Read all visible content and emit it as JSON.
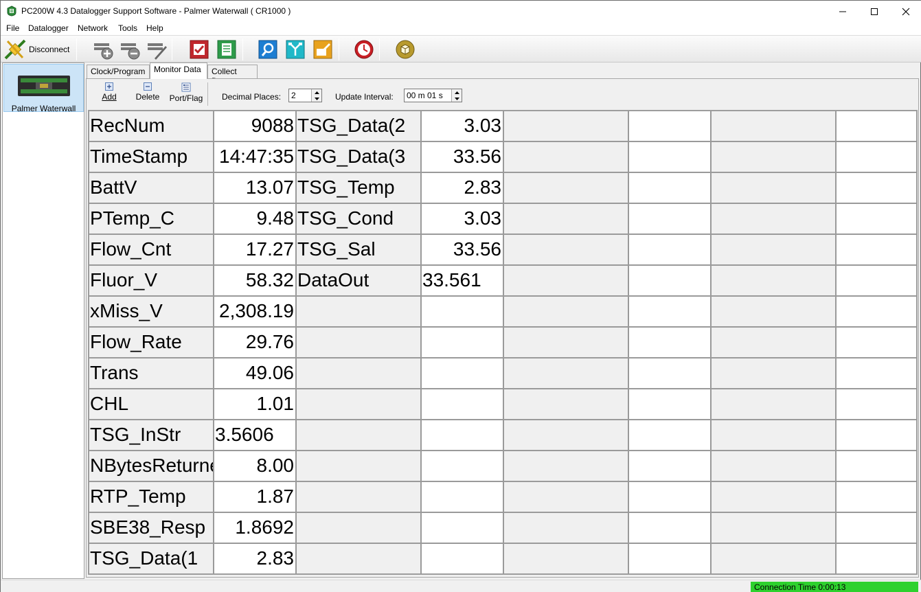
{
  "window": {
    "title": "PC200W 4.3 Datalogger Support Software - Palmer Waterwall ( CR1000 )",
    "minimize_icon": "minimize-icon",
    "maximize_icon": "maximize-icon",
    "close_icon": "close-icon"
  },
  "menu": [
    "File",
    "Datalogger",
    "Network",
    "Tools",
    "Help"
  ],
  "toolbar": {
    "disconnect_label": "Disconnect",
    "icons": [
      "add-datalogger-icon",
      "remove-datalogger-icon",
      "edit-datalogger-icon",
      "check-icon",
      "document-icon",
      "view-icon",
      "split-icon",
      "edit-file-icon",
      "clock-icon",
      "cube-icon"
    ]
  },
  "stations": [
    {
      "label": "Palmer Waterwall",
      "selected": true
    }
  ],
  "tabs": [
    {
      "label": "Clock/Program",
      "active": false
    },
    {
      "label": "Monitor Data",
      "active": true
    },
    {
      "label": "Collect Data",
      "active": false
    }
  ],
  "monitor": {
    "add_label": "Add",
    "delete_label": "Delete",
    "portflag_label": "Port/Flag",
    "decimal_places_label": "Decimal Places:",
    "decimal_places_value": "2",
    "update_interval_label": "Update Interval:",
    "update_interval_value": "00 m 01 s"
  },
  "grid": {
    "col1": [
      {
        "name": "RecNum",
        "value": "9088"
      },
      {
        "name": "TimeStamp",
        "value": "14:47:35"
      },
      {
        "name": "BattV",
        "value": "13.07"
      },
      {
        "name": "PTemp_C",
        "value": "9.48"
      },
      {
        "name": "Flow_Cnt",
        "value": "17.27"
      },
      {
        "name": "Fluor_V",
        "value": "58.32"
      },
      {
        "name": "xMiss_V",
        "value": "2,308.19"
      },
      {
        "name": "Flow_Rate",
        "value": "29.76"
      },
      {
        "name": "Trans",
        "value": "49.06"
      },
      {
        "name": "CHL",
        "value": "1.01"
      },
      {
        "name": "TSG_InStr",
        "value": "3.5606"
      },
      {
        "name": "NBytesReturned",
        "value": "8.00"
      },
      {
        "name": "RTP_Temp",
        "value": "1.87"
      },
      {
        "name": "SBE38_Resp",
        "value": "1.8692"
      },
      {
        "name": "TSG_Data(1",
        "value": "2.83"
      }
    ],
    "col2": [
      {
        "name": "TSG_Data(2",
        "value": "3.03"
      },
      {
        "name": "TSG_Data(3",
        "value": "33.56"
      },
      {
        "name": "TSG_Temp",
        "value": "2.83"
      },
      {
        "name": "TSG_Cond",
        "value": "3.03"
      },
      {
        "name": "TSG_Sal",
        "value": "33.56"
      },
      {
        "name": "DataOut",
        "value": "33.561"
      }
    ]
  },
  "status": {
    "connection_time": "Connection Time 0:00:13"
  }
}
